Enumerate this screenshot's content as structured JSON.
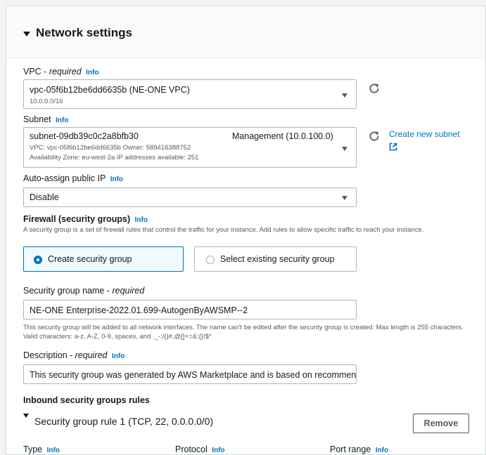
{
  "section": {
    "title": "Network settings"
  },
  "vpc": {
    "label": "VPC - ",
    "label_suffix": "required",
    "info": "Info",
    "value": "vpc-05f6b12be6dd6635b (NE-ONE VPC)",
    "cidr": "10.0.0.0/16"
  },
  "subnet": {
    "label": "Subnet",
    "info": "Info",
    "value": "subnet-09db39c0c2a8bfb30",
    "name": "Management (10.0.100.0)",
    "details1": "VPC: vpc-05f6b12be6dd6635b    Owner: 589416388752",
    "details2": "Availability Zone: eu-west-2a    IP addresses available: 251",
    "create_link": "Create new subnet"
  },
  "auto_ip": {
    "label": "Auto-assign public IP",
    "info": "Info",
    "value": "Disable"
  },
  "firewall": {
    "label": "Firewall (security groups)",
    "info": "Info",
    "description": "A security group is a set of firewall rules that control the traffic for your instance. Add rules to allow specific traffic to reach your instance.",
    "option_create": "Create security group",
    "option_existing": "Select existing security group"
  },
  "sg_name": {
    "label": "Security group name - ",
    "label_suffix": "required",
    "value": "NE-ONE Enterprise-2022.01.699-AutogenByAWSMP--2",
    "help": "This security group will be added to all network interfaces. The name can't be edited after the security group is created. Max length is 255 characters. Valid characters: a-z, A-Z, 0-9, spaces, and ._-:/()#,@[]+=&;{}!$*"
  },
  "description": {
    "label": "Description - ",
    "label_suffix": "required",
    "info": "Info",
    "value": "This security group was generated by AWS Marketplace and is based on recommend"
  },
  "inbound": {
    "title": "Inbound security groups rules",
    "rule_title": "Security group rule 1 (TCP, 22, 0.0.0.0/0)",
    "remove": "Remove",
    "col_type": "Type",
    "col_protocol": "Protocol",
    "col_port": "Port range",
    "info": "Info"
  },
  "icons": {
    "refresh": "refresh-icon",
    "external": "external-link-icon",
    "dropdown": "caret-down-icon"
  }
}
